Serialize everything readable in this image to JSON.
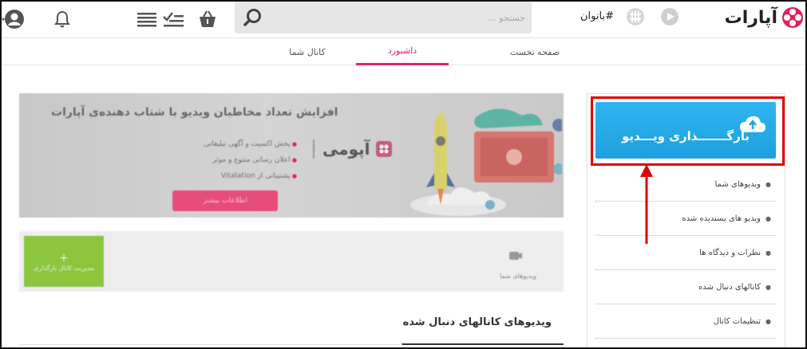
{
  "header": {
    "logo_text": "آپارات",
    "hashtag_label": "#بانوان",
    "search": {
      "placeholder": "جستجو ..."
    },
    "icons": [
      "user-icon",
      "bell-icon",
      "list-icon",
      "check-list-icon",
      "basket-icon",
      "search-icon",
      "tag-icon",
      "play-icon"
    ]
  },
  "tabs": [
    {
      "label": "صفحه نخست",
      "active": false
    },
    {
      "label": "داشبورد",
      "active": true
    },
    {
      "label": "کانال شما",
      "active": false
    }
  ],
  "banner": {
    "headline": "افزایش تعداد مخاطبان ویدیو با شتاب دهنده‌ی آپارات",
    "bullets": [
      "پخش اکسپت و آگهی تبلیغاتی",
      "اعلان رسانی متنوع و موثر",
      "پشتیبانی از Vitalation"
    ],
    "brand": "آپومی",
    "cta": "اطلاعات بیشتر"
  },
  "empty_state": {
    "text": "ویدیوهای شما",
    "action": "مدیریت کانال بارگذاری"
  },
  "section_title": "ویدیوهای کانالهای دنبال شده",
  "sidebar": {
    "upload_label": "بارگـــــــذاری ویـــدیو",
    "menu": [
      "ویدیوهای شما",
      "ویدیو های پسندیده شده",
      "نظرات و دیدگاه ها",
      "کانالهای دنبال شده",
      "تنظیمات کانال"
    ]
  },
  "colors": {
    "accent": "#e0245e",
    "upload_blue": "#1ea7e4",
    "highlight_red": "#e20000",
    "green": "#8cc63f"
  }
}
